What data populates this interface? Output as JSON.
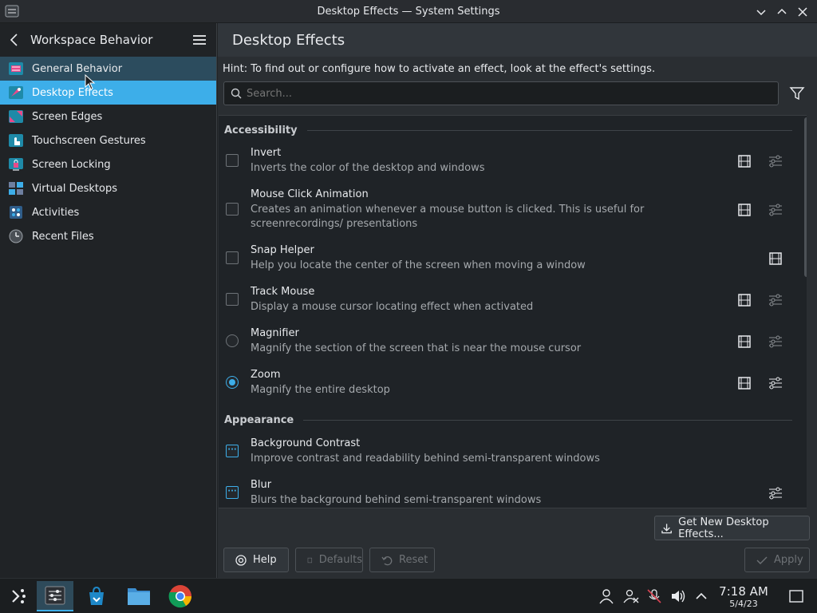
{
  "window": {
    "title": "Desktop Effects — System Settings"
  },
  "sidebar": {
    "title": "Workspace Behavior",
    "items": [
      {
        "label": "General Behavior",
        "state": "hover"
      },
      {
        "label": "Desktop Effects",
        "state": "selected"
      },
      {
        "label": "Screen Edges",
        "state": "normal"
      },
      {
        "label": "Touchscreen Gestures",
        "state": "normal"
      },
      {
        "label": "Screen Locking",
        "state": "normal"
      },
      {
        "label": "Virtual Desktops",
        "state": "normal"
      },
      {
        "label": "Activities",
        "state": "normal"
      },
      {
        "label": "Recent Files",
        "state": "normal"
      }
    ]
  },
  "main": {
    "title": "Desktop Effects",
    "hint": "Hint: To find out or configure how to activate an effect, look at the effect's settings.",
    "search_placeholder": "Search...",
    "sections": [
      {
        "label": "Accessibility"
      },
      {
        "label": "Appearance"
      }
    ],
    "effects": [
      {
        "name": "Invert",
        "desc": "Inverts the color of the desktop and windows",
        "control": "checkbox",
        "video": true,
        "configure": true
      },
      {
        "name": "Mouse Click Animation",
        "desc": "Creates an animation whenever a mouse button is clicked. This is useful for screenrecordings/ presentations",
        "control": "checkbox",
        "video": true,
        "configure": true
      },
      {
        "name": "Snap Helper",
        "desc": "Help you locate the center of the screen when moving a window",
        "control": "checkbox",
        "video": true,
        "configure": false
      },
      {
        "name": "Track Mouse",
        "desc": "Display a mouse cursor locating effect when activated",
        "control": "checkbox",
        "video": true,
        "configure": true
      },
      {
        "name": "Magnifier",
        "desc": "Magnify the section of the screen that is near the mouse cursor",
        "control": "radio-off",
        "video": true,
        "configure": true
      },
      {
        "name": "Zoom",
        "desc": "Magnify the entire desktop",
        "control": "radio-on",
        "video": true,
        "configure": true
      },
      {
        "name": "Background Contrast",
        "desc": "Improve contrast and readability behind semi-transparent windows",
        "control": "partial",
        "video": false,
        "configure": false
      },
      {
        "name": "Blur",
        "desc": "Blurs the background behind semi-transparent windows",
        "control": "partial",
        "video": false,
        "configure": true
      }
    ],
    "get_new_label": "Get New Desktop Effects...",
    "help_label": "Help",
    "defaults_label": "Defaults",
    "reset_label": "Reset",
    "apply_label": "Apply"
  },
  "taskbar": {
    "apps": [
      "application-launcher-icon",
      "system-settings-icon",
      "discover-store-icon",
      "file-manager-icon",
      "chrome-icon"
    ],
    "clock": {
      "time": "7:18 AM",
      "date": "5/4/23"
    }
  },
  "colors": {
    "accent": "#3daee9",
    "window_bg": "#2a2e32",
    "sidebar_bg": "#202326"
  }
}
